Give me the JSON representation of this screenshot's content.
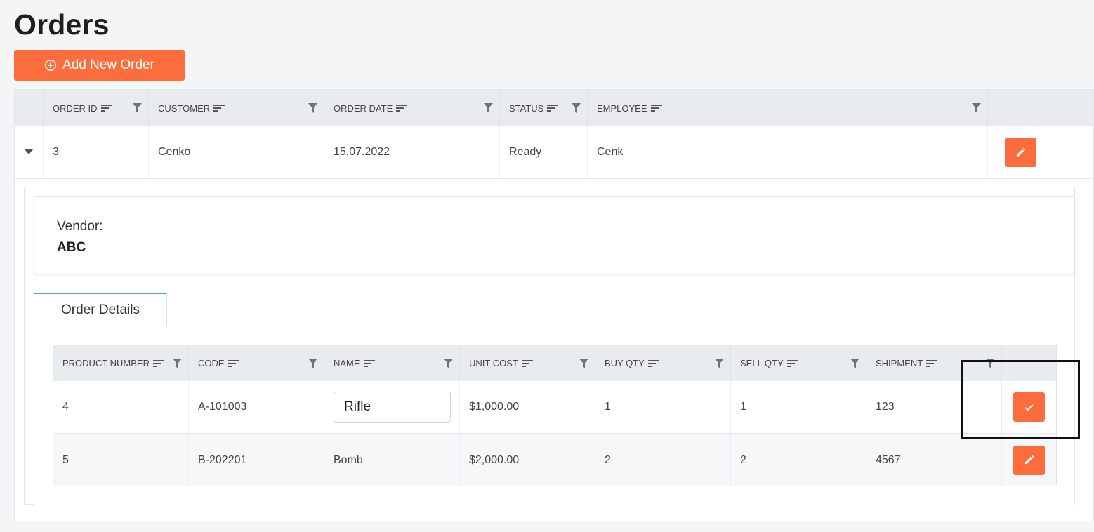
{
  "page": {
    "title": "Orders"
  },
  "toolbar": {
    "add_label": "Add New Order",
    "add_icon": "plus-circle-icon"
  },
  "colors": {
    "accent": "#fd6c3d",
    "header_bg": "#e9ecef",
    "tab_border": "#4aa3df"
  },
  "orders_grid": {
    "columns": [
      "ORDER ID",
      "CUSTOMER",
      "ORDER DATE",
      "STATUS",
      "EMPLOYEE"
    ],
    "row": {
      "order_id": "3",
      "customer": "Cenko",
      "order_date": "15.07.2022",
      "status": "Ready",
      "employee": "Cenk"
    }
  },
  "detail": {
    "vendor_label": "Vendor:",
    "vendor_value": "ABC",
    "tab_label": "Order Details",
    "columns": [
      "PRODUCT NUMBER",
      "CODE",
      "NAME",
      "UNIT COST",
      "BUY QTY",
      "SELL QTY",
      "SHIPMENT"
    ],
    "rows": [
      {
        "product_number": "4",
        "code": "A-101003",
        "name": "Rifle",
        "unit_cost": "$1,000.00",
        "buy_qty": "1",
        "sell_qty": "1",
        "shipment": "123"
      },
      {
        "product_number": "5",
        "code": "B-202201",
        "name": "Bomb",
        "unit_cost": "$2,000.00",
        "buy_qty": "2",
        "sell_qty": "2",
        "shipment": "4567"
      }
    ]
  }
}
